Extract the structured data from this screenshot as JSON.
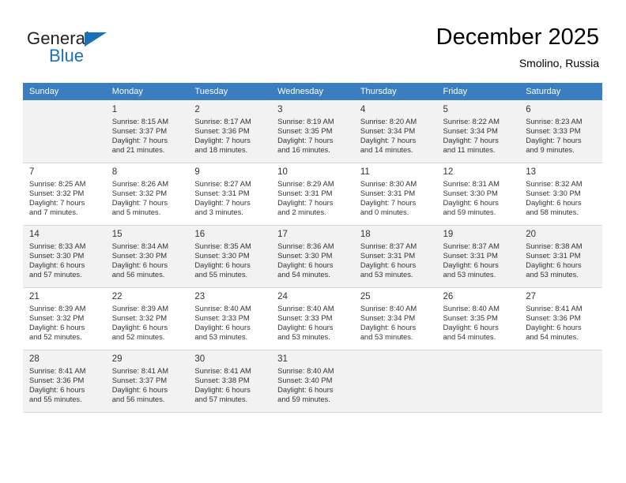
{
  "brand": {
    "name_part1": "General",
    "name_part2": "Blue"
  },
  "header": {
    "title": "December 2025",
    "subtitle": "Smolino, Russia"
  },
  "theme": {
    "header_row_bg": "#3a7dc0",
    "brand_blue": "#1b71b8",
    "shaded_row_bg": "#f2f2f2",
    "text": "#333333"
  },
  "weekday_headers": [
    "Sunday",
    "Monday",
    "Tuesday",
    "Wednesday",
    "Thursday",
    "Friday",
    "Saturday"
  ],
  "weeks": [
    {
      "shaded": true,
      "days": [
        {
          "num": "",
          "info": ""
        },
        {
          "num": "1",
          "info": "Sunrise: 8:15 AM\nSunset: 3:37 PM\nDaylight: 7 hours\nand 21 minutes."
        },
        {
          "num": "2",
          "info": "Sunrise: 8:17 AM\nSunset: 3:36 PM\nDaylight: 7 hours\nand 18 minutes."
        },
        {
          "num": "3",
          "info": "Sunrise: 8:19 AM\nSunset: 3:35 PM\nDaylight: 7 hours\nand 16 minutes."
        },
        {
          "num": "4",
          "info": "Sunrise: 8:20 AM\nSunset: 3:34 PM\nDaylight: 7 hours\nand 14 minutes."
        },
        {
          "num": "5",
          "info": "Sunrise: 8:22 AM\nSunset: 3:34 PM\nDaylight: 7 hours\nand 11 minutes."
        },
        {
          "num": "6",
          "info": "Sunrise: 8:23 AM\nSunset: 3:33 PM\nDaylight: 7 hours\nand 9 minutes."
        }
      ]
    },
    {
      "shaded": false,
      "days": [
        {
          "num": "7",
          "info": "Sunrise: 8:25 AM\nSunset: 3:32 PM\nDaylight: 7 hours\nand 7 minutes."
        },
        {
          "num": "8",
          "info": "Sunrise: 8:26 AM\nSunset: 3:32 PM\nDaylight: 7 hours\nand 5 minutes."
        },
        {
          "num": "9",
          "info": "Sunrise: 8:27 AM\nSunset: 3:31 PM\nDaylight: 7 hours\nand 3 minutes."
        },
        {
          "num": "10",
          "info": "Sunrise: 8:29 AM\nSunset: 3:31 PM\nDaylight: 7 hours\nand 2 minutes."
        },
        {
          "num": "11",
          "info": "Sunrise: 8:30 AM\nSunset: 3:31 PM\nDaylight: 7 hours\nand 0 minutes."
        },
        {
          "num": "12",
          "info": "Sunrise: 8:31 AM\nSunset: 3:30 PM\nDaylight: 6 hours\nand 59 minutes."
        },
        {
          "num": "13",
          "info": "Sunrise: 8:32 AM\nSunset: 3:30 PM\nDaylight: 6 hours\nand 58 minutes."
        }
      ]
    },
    {
      "shaded": true,
      "days": [
        {
          "num": "14",
          "info": "Sunrise: 8:33 AM\nSunset: 3:30 PM\nDaylight: 6 hours\nand 57 minutes."
        },
        {
          "num": "15",
          "info": "Sunrise: 8:34 AM\nSunset: 3:30 PM\nDaylight: 6 hours\nand 56 minutes."
        },
        {
          "num": "16",
          "info": "Sunrise: 8:35 AM\nSunset: 3:30 PM\nDaylight: 6 hours\nand 55 minutes."
        },
        {
          "num": "17",
          "info": "Sunrise: 8:36 AM\nSunset: 3:30 PM\nDaylight: 6 hours\nand 54 minutes."
        },
        {
          "num": "18",
          "info": "Sunrise: 8:37 AM\nSunset: 3:31 PM\nDaylight: 6 hours\nand 53 minutes."
        },
        {
          "num": "19",
          "info": "Sunrise: 8:37 AM\nSunset: 3:31 PM\nDaylight: 6 hours\nand 53 minutes."
        },
        {
          "num": "20",
          "info": "Sunrise: 8:38 AM\nSunset: 3:31 PM\nDaylight: 6 hours\nand 53 minutes."
        }
      ]
    },
    {
      "shaded": false,
      "days": [
        {
          "num": "21",
          "info": "Sunrise: 8:39 AM\nSunset: 3:32 PM\nDaylight: 6 hours\nand 52 minutes."
        },
        {
          "num": "22",
          "info": "Sunrise: 8:39 AM\nSunset: 3:32 PM\nDaylight: 6 hours\nand 52 minutes."
        },
        {
          "num": "23",
          "info": "Sunrise: 8:40 AM\nSunset: 3:33 PM\nDaylight: 6 hours\nand 53 minutes."
        },
        {
          "num": "24",
          "info": "Sunrise: 8:40 AM\nSunset: 3:33 PM\nDaylight: 6 hours\nand 53 minutes."
        },
        {
          "num": "25",
          "info": "Sunrise: 8:40 AM\nSunset: 3:34 PM\nDaylight: 6 hours\nand 53 minutes."
        },
        {
          "num": "26",
          "info": "Sunrise: 8:40 AM\nSunset: 3:35 PM\nDaylight: 6 hours\nand 54 minutes."
        },
        {
          "num": "27",
          "info": "Sunrise: 8:41 AM\nSunset: 3:36 PM\nDaylight: 6 hours\nand 54 minutes."
        }
      ]
    },
    {
      "shaded": true,
      "days": [
        {
          "num": "28",
          "info": "Sunrise: 8:41 AM\nSunset: 3:36 PM\nDaylight: 6 hours\nand 55 minutes."
        },
        {
          "num": "29",
          "info": "Sunrise: 8:41 AM\nSunset: 3:37 PM\nDaylight: 6 hours\nand 56 minutes."
        },
        {
          "num": "30",
          "info": "Sunrise: 8:41 AM\nSunset: 3:38 PM\nDaylight: 6 hours\nand 57 minutes."
        },
        {
          "num": "31",
          "info": "Sunrise: 8:40 AM\nSunset: 3:40 PM\nDaylight: 6 hours\nand 59 minutes."
        },
        {
          "num": "",
          "info": ""
        },
        {
          "num": "",
          "info": ""
        },
        {
          "num": "",
          "info": ""
        }
      ]
    }
  ]
}
